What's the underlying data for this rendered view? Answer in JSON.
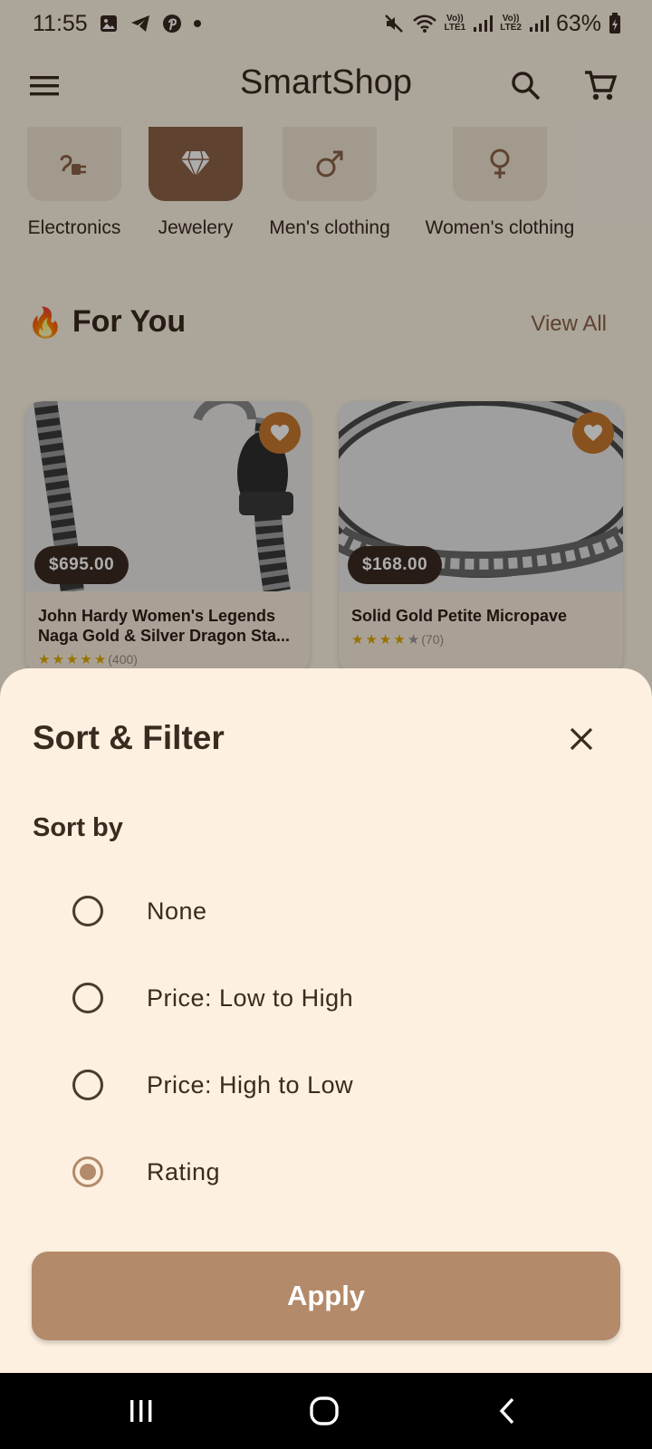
{
  "status_bar": {
    "time": "11:55",
    "battery": "63%",
    "sim1": "LTE1",
    "sim2": "LTE2",
    "icons": [
      "gallery-icon",
      "telegram-icon",
      "pinterest-icon",
      "dot-icon",
      "mute-icon",
      "wifi-icon",
      "signal-icon",
      "battery-icon"
    ]
  },
  "app_bar": {
    "title": "SmartShop",
    "icons": [
      "menu-icon",
      "search-icon",
      "cart-icon"
    ]
  },
  "categories": [
    {
      "label": "Electronics",
      "icon": "plug-icon",
      "selected": false
    },
    {
      "label": "Jewelery",
      "icon": "diamond-icon",
      "selected": true
    },
    {
      "label": "Men's clothing",
      "icon": "male-icon",
      "selected": false
    },
    {
      "label": "Women's clothing",
      "icon": "female-icon",
      "selected": false
    }
  ],
  "for_you": {
    "emoji": "🔥",
    "title": "For You",
    "view_all": "View All"
  },
  "products": [
    {
      "price": "$695.00",
      "title": "John Hardy Women's Legends Naga Gold & Silver Dragon Sta...",
      "rating": 4.5,
      "count": "(400)"
    },
    {
      "price": "$168.00",
      "title": "Solid Gold Petite Micropave",
      "rating": 4,
      "count": "(70)"
    }
  ],
  "sheet": {
    "title": "Sort & Filter",
    "sort_label": "Sort by",
    "options": [
      {
        "label": "None",
        "selected": false
      },
      {
        "label": "Price: Low to High",
        "selected": false
      },
      {
        "label": "Price: High to Low",
        "selected": false
      },
      {
        "label": "Rating",
        "selected": true
      }
    ],
    "apply_label": "Apply"
  },
  "colors": {
    "accent": "#b38a6a",
    "selected_category": "#8c6247",
    "favorite": "#c97a2e",
    "text": "#3a2a20",
    "sheet_bg": "#fdf0e0"
  },
  "nav_icons": [
    "recents-icon",
    "home-icon",
    "back-icon"
  ]
}
